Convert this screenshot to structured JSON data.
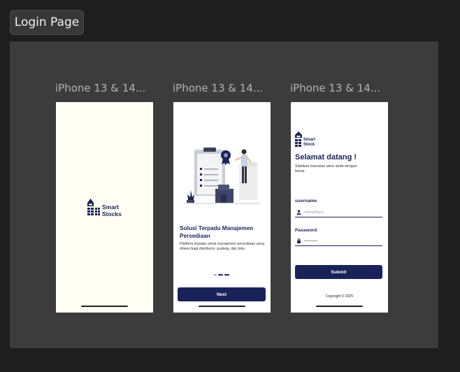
{
  "page": {
    "label": "Login Page"
  },
  "colors": {
    "brand": "#1a2359",
    "canvas": "#1e1e1e",
    "section": "#3c3c3c",
    "splash_bg": "#fffdf4"
  },
  "frames": [
    {
      "title": "iPhone 13 & 14..."
    },
    {
      "title": "iPhone 13 & 14..."
    },
    {
      "title": "iPhone 13 & 14..."
    }
  ],
  "splash": {
    "logo_line1": "Smart",
    "logo_line2": "Stocks"
  },
  "onboarding": {
    "title": "Solusi Terpadu Manajemen Persediaan",
    "description": "Platform terpadu untuk manajemen persediaan yang efisien bagi distributor, gudang, dan toko.",
    "next_label": "Next",
    "page_index": 2,
    "page_count": 3
  },
  "login": {
    "logo_line1": "Smart",
    "logo_line2": "Stock",
    "title": "Selamat datang !",
    "subtitle": "Silahkan masukan akun anda dengan benar.",
    "username_label": "username",
    "username_placeholder": "SelmaHayys",
    "password_label": "Password",
    "password_placeholder": "•••••••••••••••",
    "submit_label": "Submit",
    "copyright": "Copyright © 2025"
  },
  "icons": {
    "user": "user-icon",
    "lock": "lock-icon"
  }
}
